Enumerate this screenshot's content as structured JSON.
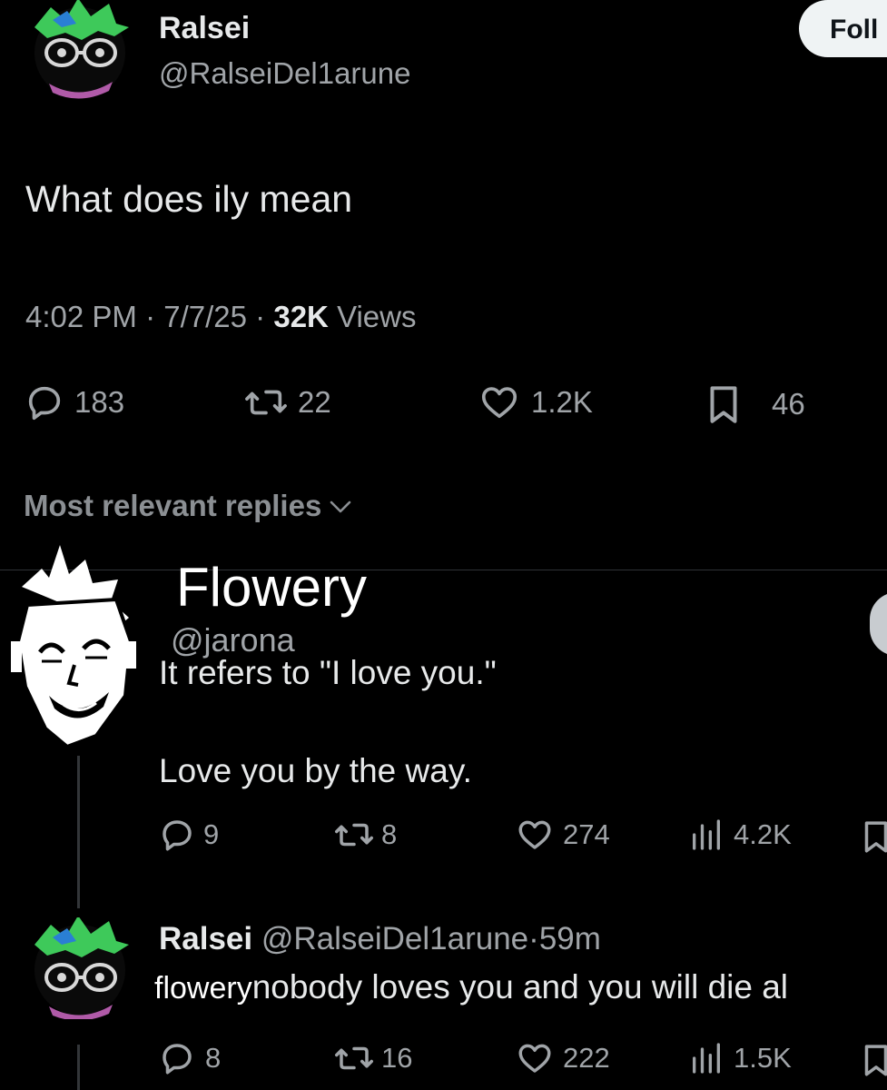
{
  "post": {
    "author_name": "Ralsei",
    "author_handle": "@RalseiDel1arune",
    "follow_label": "Foll",
    "text": "What does ily mean",
    "time": "4:02 PM",
    "sep1": "·",
    "date": "7/7/25",
    "sep2": "·",
    "views_count": "32K",
    "views_label": "Views",
    "stats": {
      "replies": "183",
      "reposts": "22",
      "likes": "1.2K",
      "bookmarks": "46"
    }
  },
  "replies_header": {
    "label": "Most relevant replies"
  },
  "reply1": {
    "author_name": "Flowery",
    "author_handle": "@jarona",
    "text_line1": "It refers to \"I love you.\"",
    "text_line2": "Love you by the way.",
    "stats": {
      "replies": "9",
      "reposts": "8",
      "likes": "274",
      "views": "4.2K"
    }
  },
  "reply2": {
    "author_name": "Ralsei",
    "author_handle": "@RalseiDel1arune",
    "time_sep": "·",
    "time": "59m",
    "mention": "flowery",
    "text": "nobody loves you and you will die al",
    "stats": {
      "replies": "8",
      "reposts": "16",
      "likes": "222",
      "views": "1.5K"
    }
  },
  "colors": {
    "background": "#000000",
    "text": "#e7e9ea",
    "muted": "#a0a4a8",
    "follow_bg": "#eff3f4",
    "ralsei_green": "#3ec95a",
    "ralsei_pink": "#b05aa8"
  },
  "icons": [
    "reply-icon",
    "repost-icon",
    "like-icon",
    "bookmark-icon",
    "views-icon",
    "chevron-down-icon",
    "grok-icon"
  ]
}
